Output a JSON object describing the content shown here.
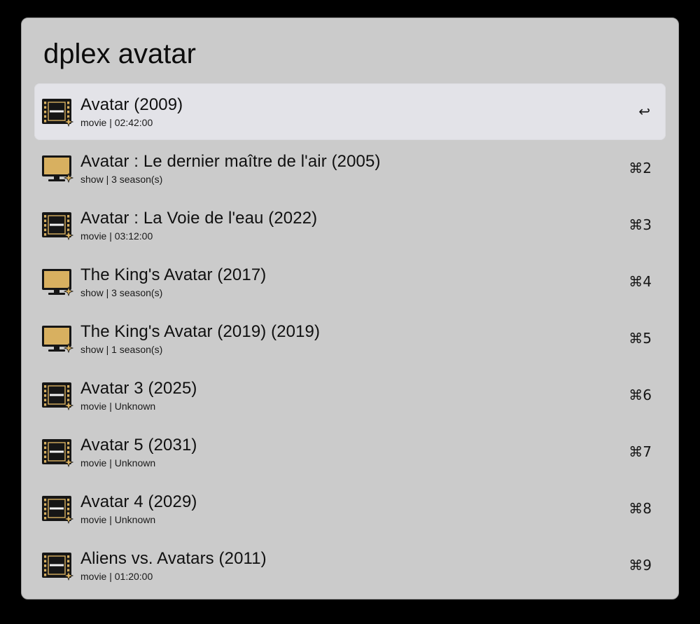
{
  "search": {
    "query": "dplex avatar"
  },
  "colors": {
    "panel": "#cbcbcb",
    "selected_row": "#e3e3e8",
    "icon_gold": "#d8b060",
    "icon_dark": "#161616"
  },
  "results": [
    {
      "title": "Avatar (2009)",
      "subtitle": "movie | 02:42:00",
      "shortcut": "↩",
      "icon": "film-icon",
      "selected": true
    },
    {
      "title": "Avatar : Le dernier maître de l'air (2005)",
      "subtitle": "show | 3 season(s)",
      "shortcut": "⌘2",
      "icon": "tv-icon",
      "selected": false
    },
    {
      "title": "Avatar : La Voie de l'eau (2022)",
      "subtitle": "movie | 03:12:00",
      "shortcut": "⌘3",
      "icon": "film-icon",
      "selected": false
    },
    {
      "title": "The King's Avatar (2017)",
      "subtitle": "show | 3 season(s)",
      "shortcut": "⌘4",
      "icon": "tv-icon",
      "selected": false
    },
    {
      "title": "The King's Avatar (2019) (2019)",
      "subtitle": "show | 1 season(s)",
      "shortcut": "⌘5",
      "icon": "tv-icon",
      "selected": false
    },
    {
      "title": "Avatar 3 (2025)",
      "subtitle": "movie | Unknown",
      "shortcut": "⌘6",
      "icon": "film-icon",
      "selected": false
    },
    {
      "title": "Avatar 5 (2031)",
      "subtitle": "movie | Unknown",
      "shortcut": "⌘7",
      "icon": "film-icon",
      "selected": false
    },
    {
      "title": "Avatar 4 (2029)",
      "subtitle": "movie | Unknown",
      "shortcut": "⌘8",
      "icon": "film-icon",
      "selected": false
    },
    {
      "title": "Aliens vs. Avatars (2011)",
      "subtitle": "movie | 01:20:00",
      "shortcut": "⌘9",
      "icon": "film-icon",
      "selected": false
    }
  ]
}
